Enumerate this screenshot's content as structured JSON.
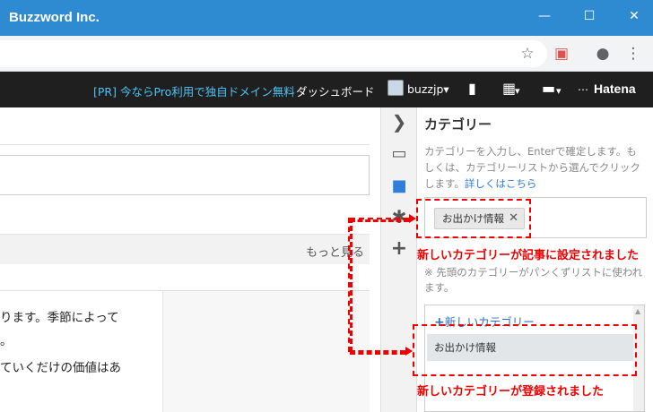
{
  "window": {
    "title": "Buzzword Inc.",
    "minimize": "—",
    "maximize": "☐",
    "close": "✕"
  },
  "toolbar": {
    "star_icon": "☆",
    "ext_icon": "▣",
    "profile_icon": "●",
    "menu_icon": "⋮"
  },
  "header": {
    "promo": "[PR] 今ならPro利用で独自ドメイン無料",
    "dashboard": "ダッシュボード",
    "username": "buzzjp",
    "dropdown": "▾",
    "bookmark_icon": "▮",
    "grid_icon": "▦",
    "comment_icon": "▬",
    "brand": "Hatena",
    "brand_mark": "⋯"
  },
  "editor": {
    "more": "もっと見る",
    "body_lines": [
      "ります。季節によって",
      "。",
      "ていくだけの価値はあ"
    ]
  },
  "strip": {
    "chevron": "❯",
    "image_icon": "▭",
    "folder_icon": "■",
    "gear_icon": "✱",
    "plus_icon": "+"
  },
  "panel": {
    "title": "カテゴリー",
    "desc": "カテゴリーを入力し、Enterで確定します。もしくは、カテゴリーリストから選んでクリックします。",
    "desc_link": "詳しくはこちら",
    "tag_label": "お出かけ情報",
    "tag_remove": "✕",
    "note": "※ 先頭のカテゴリーがパンくずリストに使われます。",
    "new_category_plus": "+",
    "new_category": "新しいカテゴリー",
    "list_item": "お出かけ情報",
    "scroll_up": "▲"
  },
  "annotations": {
    "top": "新しいカテゴリーが記事に設定されました",
    "bottom": "新しいカテゴリーが登録されました"
  },
  "colors": {
    "titlebar": "#2f8bd1",
    "header": "#1f1f1f",
    "annotation": "#e00000",
    "link": "#2f7ed8"
  }
}
